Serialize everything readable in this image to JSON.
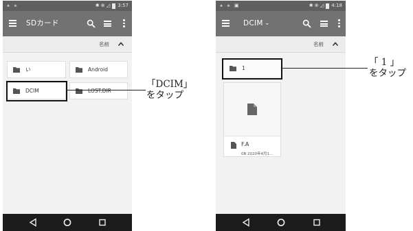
{
  "left_screen": {
    "status": {
      "left_icons": "⚹ ⚹",
      "right_icons": "✱ ⊕ ◿",
      "time": "3:57"
    },
    "appbar": {
      "title": "SDカード",
      "search_icon": "search-icon",
      "view_icon": "list-view-icon",
      "more_icon": "more-vert-icon"
    },
    "sort": {
      "label": "名前",
      "direction": "ascending"
    },
    "items": [
      {
        "label": "い"
      },
      {
        "label": "Android"
      },
      {
        "label": "DCIM"
      },
      {
        "label": "LOST.DIR"
      }
    ],
    "nav": [
      "back-icon",
      "home-icon",
      "recents-icon"
    ]
  },
  "right_screen": {
    "status": {
      "left_icons": "⚹ ⚹ ▣",
      "right_icons": "✱ ⊕ ◿",
      "time": "4:18"
    },
    "appbar": {
      "title": "DCIM",
      "caret": "⌄",
      "search_icon": "search-icon",
      "view_icon": "list-view-icon",
      "more_icon": "more-vert-icon"
    },
    "sort": {
      "label": "名前",
      "direction": "ascending"
    },
    "items": [
      {
        "label": "1"
      }
    ],
    "document": {
      "name": "F.A",
      "meta": "0B 2020年4月1..."
    },
    "nav": [
      "back-icon",
      "home-icon",
      "recents-icon"
    ]
  },
  "callouts": {
    "left": {
      "line1": "「DCIM」",
      "line2": "をタップ"
    },
    "right": {
      "line1": "「 1 」",
      "line2": "をタップ"
    }
  },
  "colors": {
    "statusbar": "#5f5f5f",
    "appbar": "#727272",
    "navbar": "#1c1c1c",
    "background": "#f2f2f2"
  }
}
